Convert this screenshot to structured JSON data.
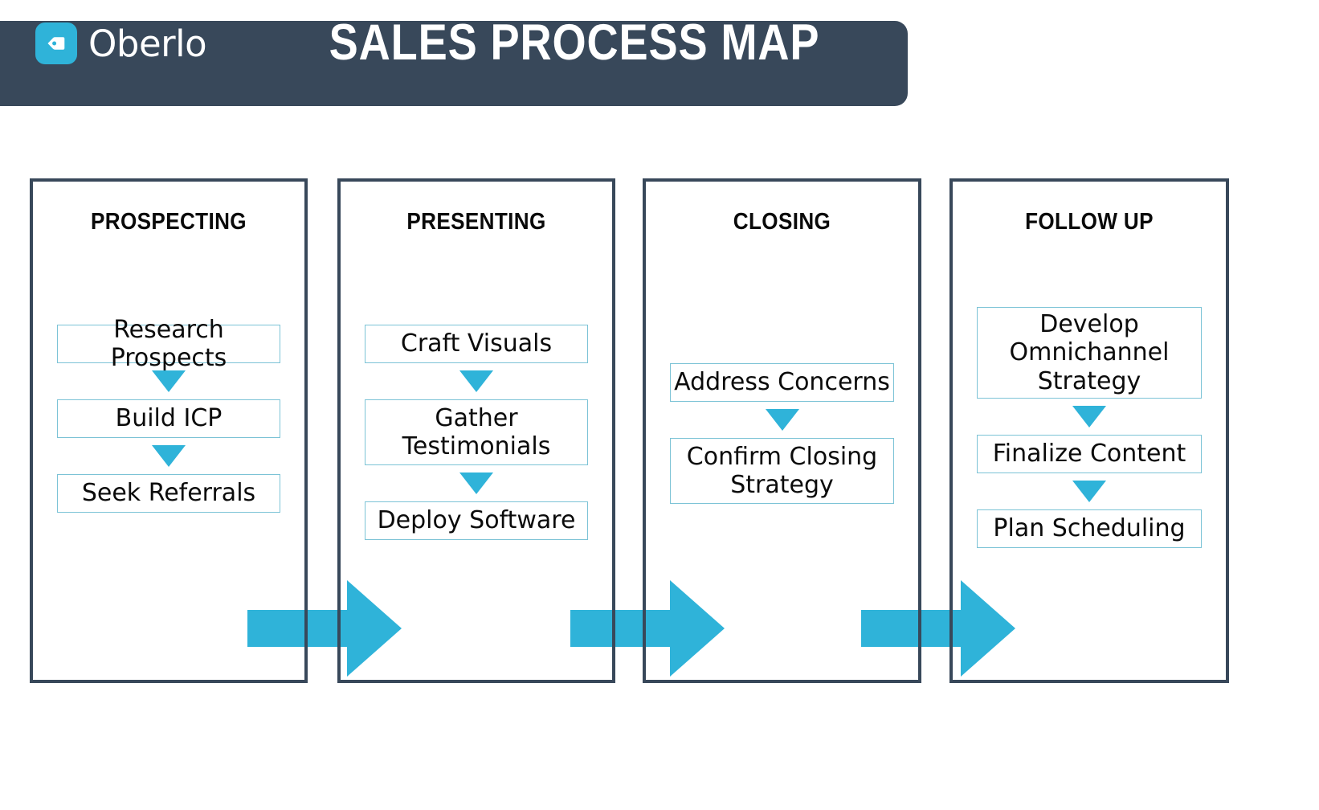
{
  "header": {
    "brand_name": "Oberlo",
    "brand_icon": "price-tag-icon",
    "title": "SALES PROCESS MAP",
    "bar_color": "#38485a",
    "accent_color": "#2fb3d9"
  },
  "colors": {
    "accent": "#2fb3d9",
    "dark": "#38485a",
    "box_border": "#7cc3d6",
    "text": "#0b0b0b"
  },
  "stages": [
    {
      "title": "PROSPECTING",
      "steps": [
        "Research Prospects",
        "Build ICP",
        "Seek Referrals"
      ]
    },
    {
      "title": "PRESENTING",
      "steps": [
        "Craft Visuals",
        "Gather Testimonials",
        "Deploy Software"
      ]
    },
    {
      "title": "CLOSING",
      "steps": [
        "Address Concerns",
        "Confirm Closing Strategy"
      ]
    },
    {
      "title": "FOLLOW UP",
      "steps": [
        "Develop Omnichannel Strategy",
        "Finalize Content",
        "Plan Scheduling"
      ]
    }
  ],
  "transitions": [
    {
      "from": "PROSPECTING",
      "to": "PRESENTING"
    },
    {
      "from": "PRESENTING",
      "to": "CLOSING"
    },
    {
      "from": "CLOSING",
      "to": "FOLLOW UP"
    }
  ]
}
